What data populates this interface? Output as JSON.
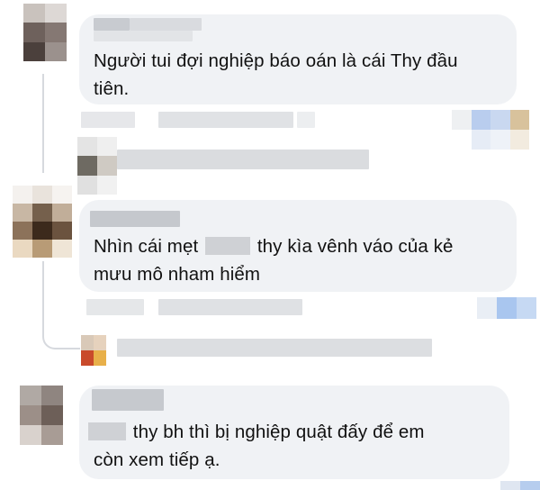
{
  "comments": [
    {
      "text_line1": "Người tui đợi nghiệp báo oán là cái Thy đầu",
      "text_line2": "tiên."
    },
    {
      "text_line1_a": "Nhìn cái mẹt",
      "text_line1_b": "thy kìa vênh váo của kẻ",
      "text_line2": "mưu mô nham hiểm"
    },
    {
      "text_line1": "thy bh thì bị nghiệp quật đấy để em",
      "text_line2": "còn xem tiếp ạ."
    }
  ],
  "colors": {
    "bubble": "#f0f2f5",
    "pixelated": "#cfd1d5",
    "reaction_blue": "#a9c6ef"
  },
  "icons": [
    "avatar",
    "reaction-icon"
  ]
}
